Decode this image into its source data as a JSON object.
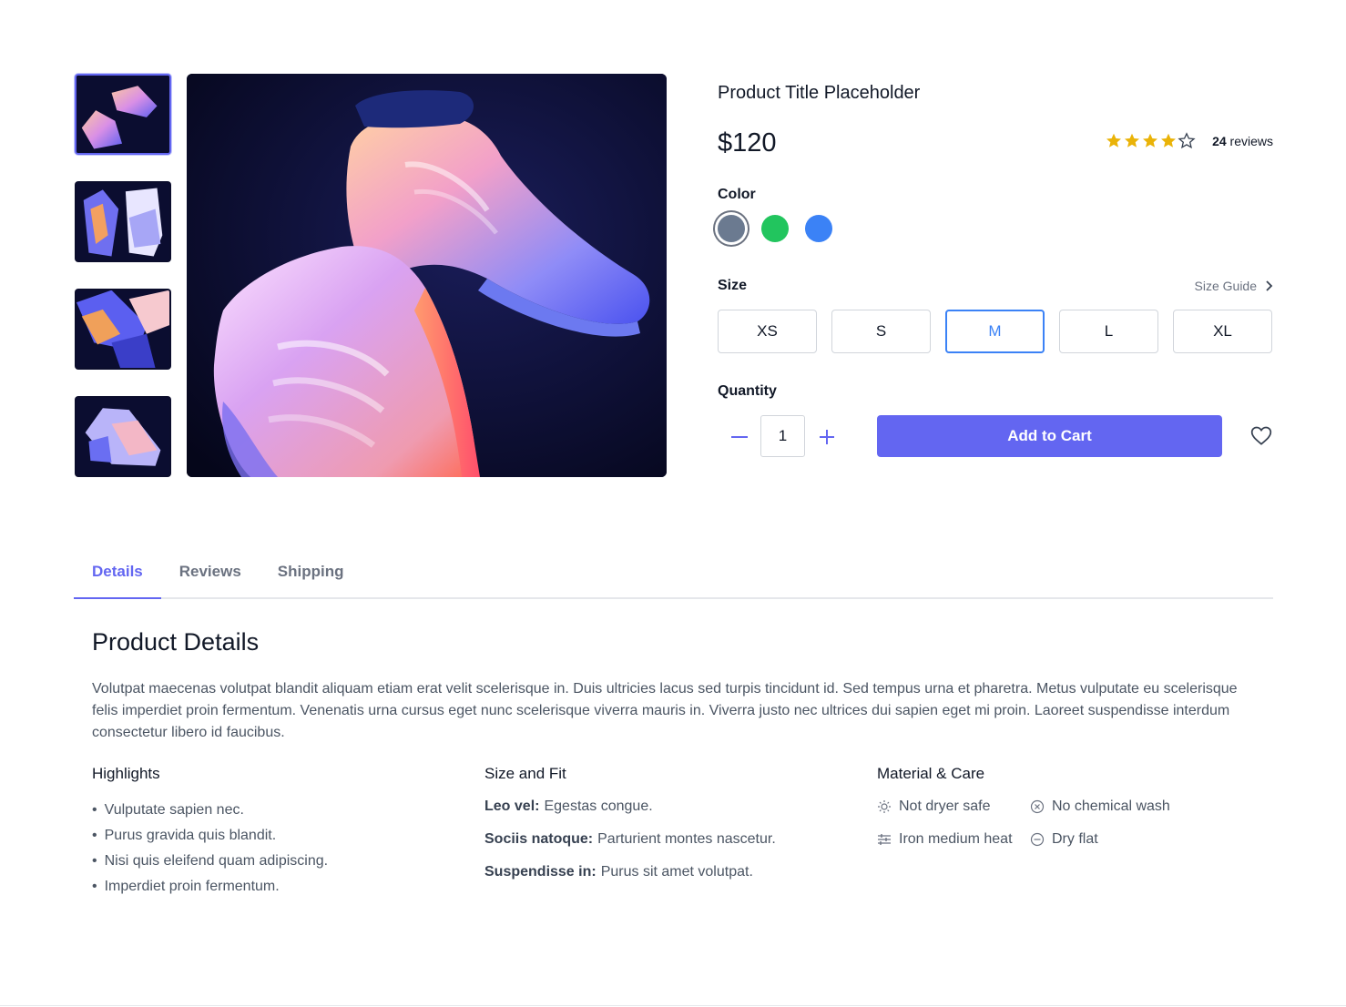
{
  "gallery": {
    "thumbnails": [
      "shoe-thumb-1",
      "shoe-thumb-2",
      "shoe-thumb-3",
      "shoe-thumb-4"
    ],
    "selected_index": 0
  },
  "product": {
    "title": "Product Title Placeholder",
    "price": "$120",
    "rating": 4,
    "rating_max": 5,
    "reviews_count": "24",
    "reviews_label": "reviews"
  },
  "color": {
    "label": "Color",
    "options": [
      "#6b7a90",
      "#22c55e",
      "#3b82f6"
    ],
    "selected_index": 0
  },
  "size": {
    "label": "Size",
    "guide_label": "Size Guide",
    "options": [
      "XS",
      "S",
      "M",
      "L",
      "XL"
    ],
    "selected": "M"
  },
  "quantity": {
    "label": "Quantity",
    "value": "1"
  },
  "actions": {
    "add_to_cart": "Add to Cart"
  },
  "tabs": [
    {
      "label": "Details",
      "active": true
    },
    {
      "label": "Reviews",
      "active": false
    },
    {
      "label": "Shipping",
      "active": false
    }
  ],
  "details": {
    "title": "Product Details",
    "description": "Volutpat maecenas volutpat blandit aliquam etiam erat velit scelerisque in. Duis ultricies lacus sed turpis tincidunt id. Sed tempus urna et pharetra. Metus vulputate eu scelerisque felis imperdiet proin fermentum. Venenatis urna cursus eget nunc scelerisque viverra mauris in. Viverra justo nec ultrices dui sapien eget mi proin. Laoreet suspendisse interdum consectetur libero id faucibus.",
    "highlights": {
      "title": "Highlights",
      "items": [
        "Vulputate sapien nec.",
        "Purus gravida quis blandit.",
        "Nisi quis eleifend quam adipiscing.",
        "Imperdiet proin fermentum."
      ]
    },
    "size_fit": {
      "title": "Size and Fit",
      "items": [
        {
          "key": "Leo vel:",
          "value": "Egestas congue."
        },
        {
          "key": "Sociis natoque:",
          "value": "Parturient montes nascetur."
        },
        {
          "key": "Suspendisse in:",
          "value": "Purus sit amet volutpat."
        }
      ]
    },
    "care": {
      "title": "Material & Care",
      "items": [
        {
          "icon": "sun-icon",
          "label": "Not dryer safe"
        },
        {
          "icon": "x-circle-icon",
          "label": "No chemical wash"
        },
        {
          "icon": "sliders-icon",
          "label": "Iron medium heat"
        },
        {
          "icon": "minus-circle-icon",
          "label": "Dry flat"
        }
      ]
    }
  },
  "theme": {
    "accent": "#6366f1",
    "star": "#eab308",
    "selected_size": "#3b82f6"
  }
}
